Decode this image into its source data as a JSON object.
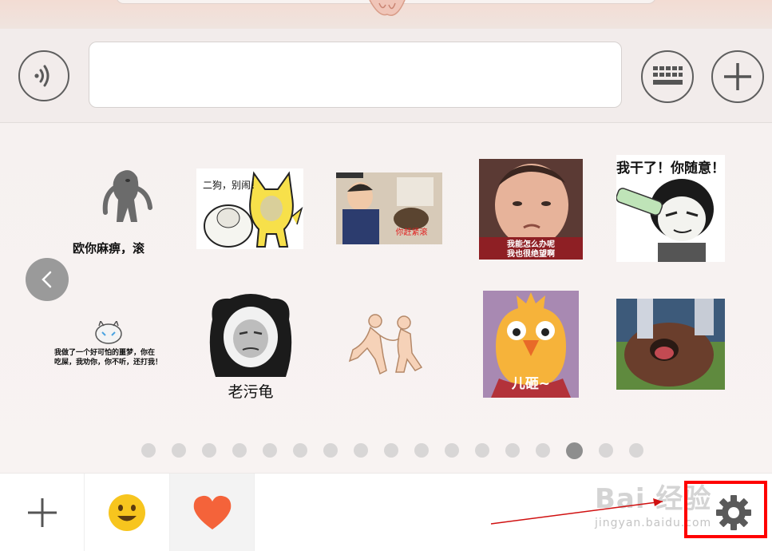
{
  "input_bar": {
    "voice_icon": "voice-waves-icon",
    "keyboard_icon": "keyboard-icon",
    "more_icon": "plus-icon",
    "message_value": ""
  },
  "stickers": [
    {
      "row": 1,
      "col": 1,
      "caption": "欧你麻痹，滚",
      "desc_icon": "gray-figure-sticker"
    },
    {
      "row": 1,
      "col": 2,
      "caption": "二狗，别闹！",
      "desc_icon": "cat-and-blob-sticker"
    },
    {
      "row": 1,
      "col": 3,
      "caption": "你赶紧滚",
      "desc_icon": "child-photo-sticker"
    },
    {
      "row": 1,
      "col": 4,
      "caption_line1": "我能怎么办呢",
      "caption_line2": "我也很绝望啊",
      "desc_icon": "crying-baby-sticker"
    },
    {
      "row": 1,
      "col": 5,
      "caption": "我干了！你随意！",
      "desc_icon": "panda-drinking-sticker"
    },
    {
      "row": 2,
      "col": 1,
      "caption_line1": "我做了一个好可怕的噩梦，你在",
      "caption_line2": "吃屎，我劝你，你不听，还打我！",
      "desc_icon": "crying-cat-sticker"
    },
    {
      "row": 2,
      "col": 2,
      "caption": "老污龟",
      "desc_icon": "panda-face-sticker"
    },
    {
      "row": 2,
      "col": 3,
      "caption": "",
      "desc_icon": "cartoon-figures-sticker"
    },
    {
      "row": 2,
      "col": 4,
      "caption": "儿砸~",
      "desc_icon": "yellow-chick-sticker"
    },
    {
      "row": 2,
      "col": 5,
      "caption": "",
      "desc_icon": "barking-dog-sticker"
    }
  ],
  "pager": {
    "total": 17,
    "active_index": 14
  },
  "bottom_tabs": [
    {
      "name": "add",
      "icon": "plus-icon"
    },
    {
      "name": "emoji",
      "icon": "smiley-face-icon"
    },
    {
      "name": "favorites",
      "icon": "heart-icon"
    }
  ],
  "settings": {
    "icon": "gear-icon"
  },
  "watermark": {
    "logo": "Bai 经验",
    "url": "jingyan.baidu.com"
  },
  "colors": {
    "highlight": "#ff0000",
    "heart": "#f4633a",
    "smiley": "#f7c51e"
  }
}
